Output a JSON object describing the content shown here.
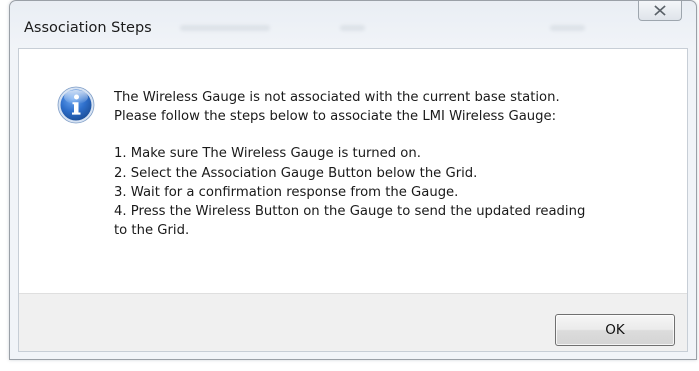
{
  "window": {
    "title": "Association Steps",
    "close_icon": "close-icon"
  },
  "dialog": {
    "icon": "information-icon",
    "message_line1": "The Wireless Gauge is not associated with the current base station.",
    "message_line2": "Please follow the steps below to associate the LMI Wireless Gauge:",
    "steps": [
      "1. Make sure The Wireless Gauge is turned on.",
      "2. Select the Association Gauge Button below the Grid.",
      "3. Wait for a confirmation response from the Gauge.",
      "4. Press the Wireless Button on the Gauge to send the updated reading",
      "to the Grid."
    ]
  },
  "buttons": {
    "ok_label": "OK"
  },
  "colors": {
    "info_icon_blue": "#1d5fb8",
    "window_border": "#9aa0a7",
    "footer_background": "#f0f0f0"
  }
}
